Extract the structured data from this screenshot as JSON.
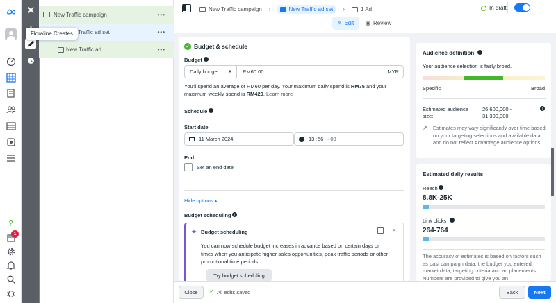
{
  "tree": {
    "campaign_label": "New Traffic campaign",
    "adset_label": "New Traffic ad set",
    "ad_label": "New Traffic ad",
    "more_label": "•••"
  },
  "tooltip": "Floraline Creates",
  "rail": {
    "notification_count": "1"
  },
  "breadcrumb": {
    "campaign": "New Traffic campaign",
    "adset": "New Traffic ad set",
    "ad": "1 Ad"
  },
  "status": {
    "label": "In draft"
  },
  "tabs": {
    "edit": "Edit",
    "review": "Review"
  },
  "section": {
    "title": "Budget & schedule"
  },
  "budget": {
    "label": "Budget",
    "type": "Daily budget",
    "amount": "RM60.00",
    "currency": "MYR",
    "note_1": "You'll spend an average of RM60 per day. Your maximum daily spend is ",
    "max_daily": "RM75",
    "note_2": " and your maximum weekly spend is ",
    "max_weekly": "RM420",
    "note_3": ". ",
    "learn_more": "Learn more"
  },
  "schedule": {
    "label": "Schedule",
    "start_label": "Start date",
    "start_date": "11 March 2024",
    "hour": "13",
    "minute": "56",
    "tz": "+08",
    "end_label": "End",
    "end_checkbox": "Set an end date",
    "hide_options": "Hide options ▴"
  },
  "budget_scheduling": {
    "label": "Budget scheduling",
    "callout_title": "Budget scheduling",
    "callout_text": "You can now schedule budget increases in advance based on certain days or times when you anticipate higher sales opportunities, peak traffic periods or other promotional time periods.",
    "cta": "Try budget scheduling"
  },
  "audience": {
    "title": "Audience definition",
    "summary": "Your audience selection is fairly broad.",
    "specific": "Specific",
    "broad": "Broad",
    "size_label": "Estimated audience size:",
    "size_value": "26,600,000 - 31,300,000",
    "disclaimer": "Estimates may vary significantly over time based on your targeting selections and available data and do not reflect Advantage audience options."
  },
  "results": {
    "title": "Estimated daily results",
    "reach_label": "Reach",
    "reach_value": "8.8K-25K",
    "reach_fill": 0.05,
    "clicks_label": "Link clicks",
    "clicks_value": "264-764",
    "clicks_fill": 0.05,
    "accuracy_text": "The accuracy of estimates is based on factors such as past campaign data, the budget you entered, market data, targeting criteria and ad placements. Numbers are provided to give you an"
  },
  "footer": {
    "close": "Close",
    "saved": "All edits saved",
    "back": "Back",
    "next": "Next"
  },
  "colors": {
    "accent": "#1877f2",
    "green": "#42b72a",
    "draft": "#63be09"
  }
}
